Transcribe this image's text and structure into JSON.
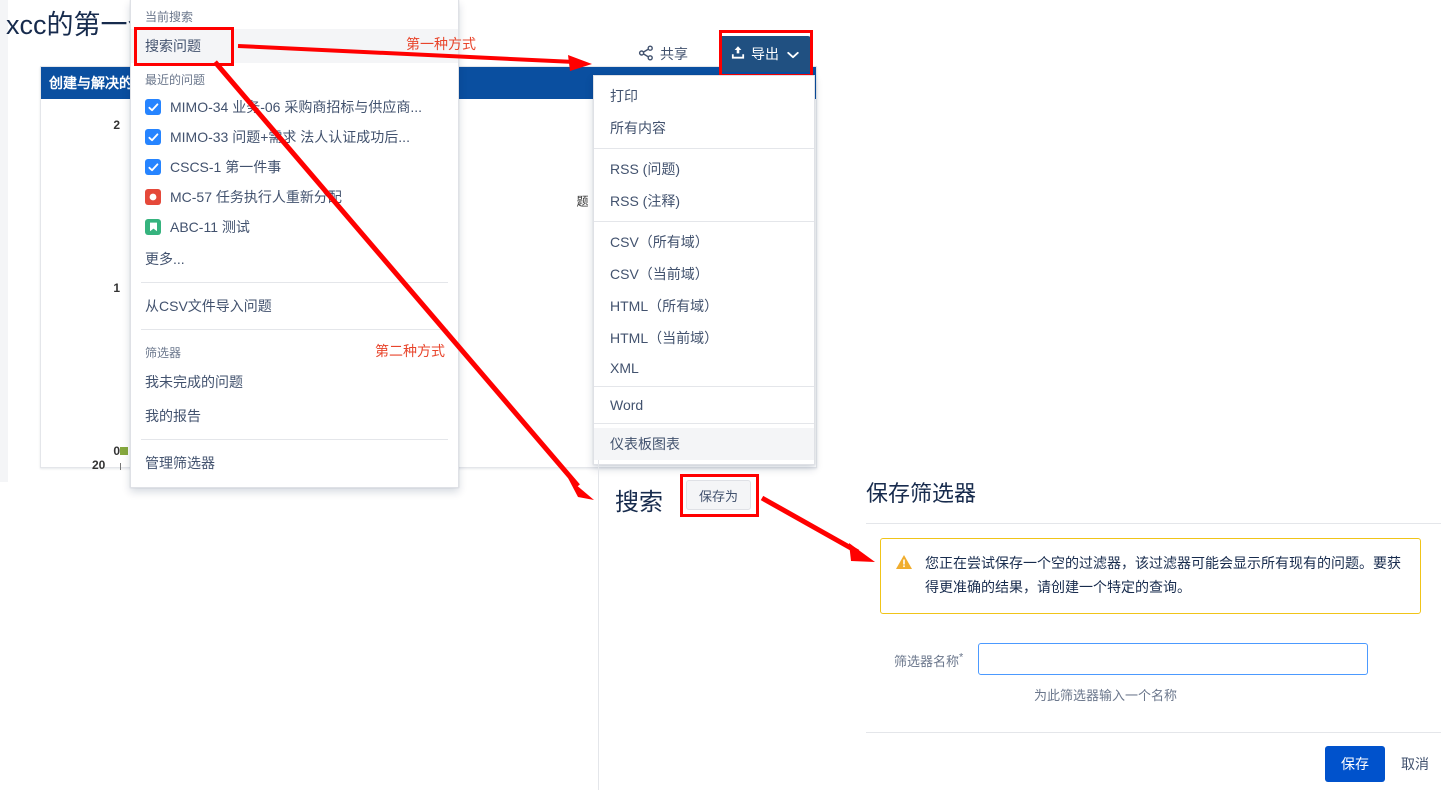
{
  "dashboard": {
    "title": "xcc的第一个",
    "gadget_title": "创建与解决的问",
    "y_axis": {
      "labels": [
        "2",
        "1",
        "0"
      ],
      "title": "题"
    },
    "x_axis": {
      "labels": [
        "20"
      ]
    }
  },
  "search_menu": {
    "section_current": "当前搜索",
    "search_issues": "搜索问题",
    "section_recent": "最近的问题",
    "recent_issues": [
      {
        "icon": "task-done-icon",
        "icon_color": "#2684ff",
        "text": "MIMO-34 业务-06 采购商招标与供应商..."
      },
      {
        "icon": "task-done-icon",
        "icon_color": "#2684ff",
        "text": "MIMO-33 问题+需求 法人认证成功后..."
      },
      {
        "icon": "task-done-icon",
        "icon_color": "#2684ff",
        "text": "CSCS-1 第一件事"
      },
      {
        "icon": "bug-icon",
        "icon_color": "#e5493a",
        "text": "MC-57 任务执行人重新分配"
      },
      {
        "icon": "story-icon",
        "icon_color": "#36b37e",
        "text": "ABC-11 测试"
      }
    ],
    "more": "更多...",
    "import_csv": "从CSV文件导入问题",
    "section_filters": "筛选器",
    "filter_items": [
      "我未完成的问题",
      "我的报告"
    ],
    "manage_filters": "管理筛选器"
  },
  "toolbar": {
    "share_label": "共享",
    "export_label": "导出"
  },
  "export_menu": {
    "groups": [
      {
        "items": [
          "打印",
          "所有内容"
        ]
      },
      {
        "items": [
          "RSS (问题)",
          "RSS (注释)"
        ]
      },
      {
        "items": [
          "CSV（所有域）",
          "CSV（当前域）",
          "HTML（所有域）",
          "HTML（当前域）",
          "XML"
        ]
      },
      {
        "items": [
          "Word"
        ]
      },
      {
        "items": [
          "仪表板图表"
        ]
      }
    ],
    "active_item": "仪表板图表"
  },
  "search_bar": {
    "label": "搜索",
    "save_as": "保存为"
  },
  "save_filter_dialog": {
    "title": "保存筛选器",
    "warning_icon": "warning-icon",
    "warning_text": "您正在尝试保存一个空的过滤器，该过滤器可能会显示所有现有的问题。要获得更准确的结果，请创建一个特定的查询。",
    "field_label": "筛选器名称",
    "field_required_mark": "*",
    "field_value": "",
    "field_placeholder": "",
    "field_hint": "为此筛选器输入一个名称",
    "save_button": "保存",
    "cancel_button": "取消"
  },
  "annotations": {
    "first_method": "第一种方式",
    "second_method": "第二种方式",
    "color": "#e8452c"
  },
  "colors": {
    "accent_blue": "#0052cc",
    "export_blue": "#205081",
    "gadget_header": "#0a4fa0",
    "annotation_red": "#ff0000",
    "warning_border": "#f0c419"
  }
}
